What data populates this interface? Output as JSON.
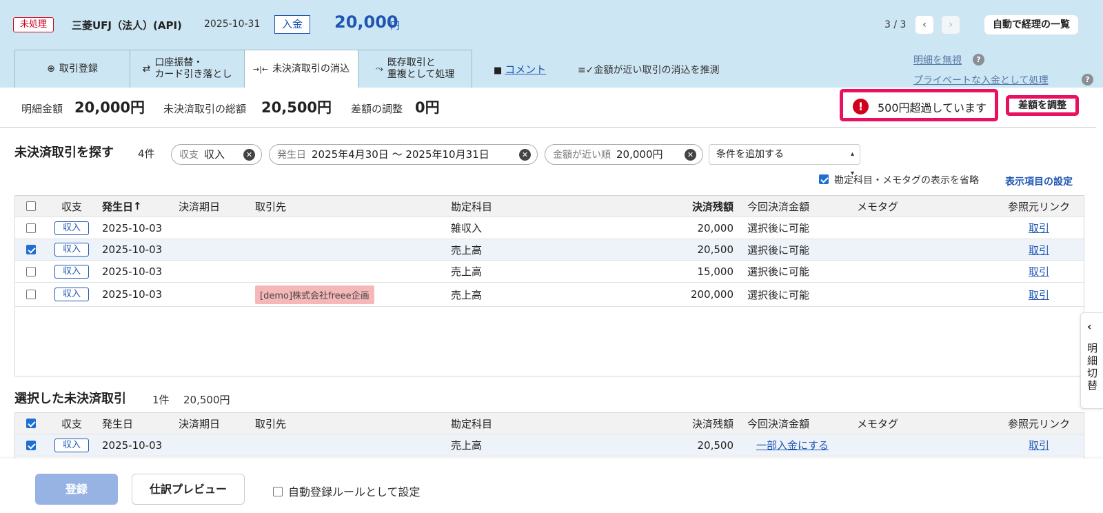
{
  "header": {
    "status_badge": "未処理",
    "bank_name": "三菱UFJ（法人）(API)",
    "date": "2025-10-31",
    "type": "入金",
    "amount": "20,000",
    "amount_unit": "円",
    "pager": "3 / 3",
    "prev_icon": "‹",
    "next_icon": "›",
    "auto_list_button": "自動で経理の一覧"
  },
  "tabs": [
    {
      "icon": "⊕",
      "label": "取引登録"
    },
    {
      "icon": "⇄",
      "label": "口座振替・\nカード引き落とし"
    },
    {
      "icon": "→|←",
      "label": "未決済取引の消込"
    },
    {
      "icon": "⤳",
      "label": "既存取引と\n重複として処理"
    }
  ],
  "comment_link": "コメント",
  "guess_link": "金額が近い取引の消込を推測",
  "ignore_link": "明細を無視",
  "private_link": "プライベートな入金として処理",
  "summary": {
    "statement_label": "明細金額",
    "statement_value": "20,000円",
    "unsettled_total_label": "未決済取引の総額",
    "unsettled_total_value": "20,500円",
    "diff_label": "差額の調整",
    "diff_value": "0円",
    "warning": "500円超過しています",
    "adjust_button": "差額を調整"
  },
  "search": {
    "title": "未決済取引を探す",
    "count": "4件",
    "chips": [
      {
        "key": "収支",
        "value": "収入"
      },
      {
        "key": "発生日",
        "value": "2025年4月30日 〜 2025年10月31日"
      },
      {
        "key": "金額が近い順",
        "value": "20,000円"
      }
    ],
    "add_condition": "条件を追加する",
    "omit_label": "勘定科目・メモタグの表示を省略",
    "display_settings": "表示項目の設定"
  },
  "columns": {
    "type": "収支",
    "date": "発生日",
    "date_sort": "↑",
    "due": "決済期日",
    "partner": "取引先",
    "account": "勘定科目",
    "balance": "決済残額",
    "now_amount": "今回決済金額",
    "memo": "メモタグ",
    "link": "参照元リンク"
  },
  "rows": [
    {
      "type": "収入",
      "date": "2025-10-03",
      "partner": "",
      "account": "雑収入",
      "balance": "20,000",
      "now": "選択後に可能",
      "link": "取引",
      "checked": false
    },
    {
      "type": "収入",
      "date": "2025-10-03",
      "partner": "",
      "account": "売上高",
      "balance": "20,500",
      "now": "選択後に可能",
      "link": "取引",
      "checked": true
    },
    {
      "type": "収入",
      "date": "2025-10-03",
      "partner": "",
      "account": "売上高",
      "balance": "15,000",
      "now": "選択後に可能",
      "link": "取引",
      "checked": false
    },
    {
      "type": "収入",
      "date": "2025-10-03",
      "partner": "[demo]株式会社freee企画",
      "account": "売上高",
      "balance": "200,000",
      "now": "選択後に可能",
      "link": "取引",
      "checked": false
    }
  ],
  "selected": {
    "title": "選択した未決済取引",
    "count": "1件",
    "total": "20,500円",
    "rows": [
      {
        "type": "収入",
        "date": "2025-10-03",
        "account": "売上高",
        "balance": "20,500",
        "now": "一部入金にする",
        "link": "取引"
      }
    ]
  },
  "side_tab": {
    "icon": "‹",
    "label": "明細切替"
  },
  "footer": {
    "register_button": "登録",
    "preview_button": "仕訳プレビュー",
    "auto_rule_label": "自動登録ルールとして設定"
  }
}
